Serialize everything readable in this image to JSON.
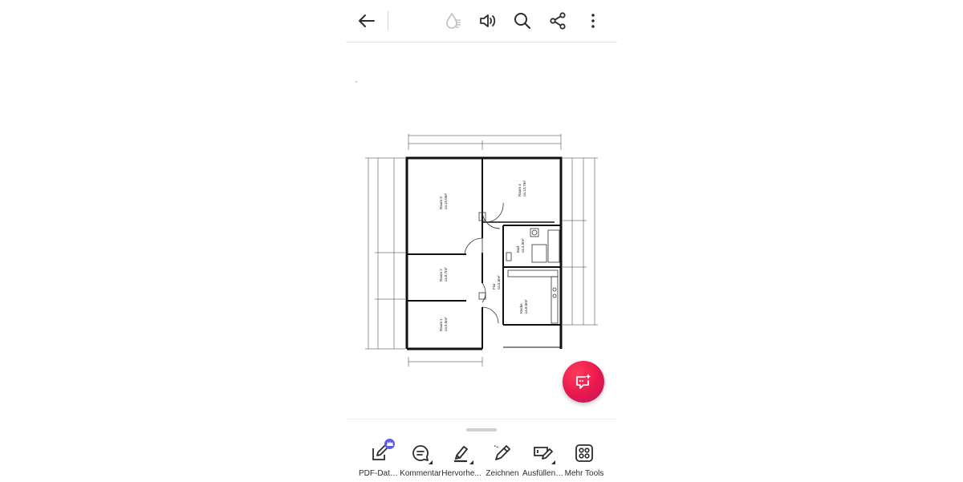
{
  "colors": {
    "fab_gradient_start": "#ff3b5c",
    "fab_gradient_end": "#b31a6a",
    "icon": "#2c2c2c",
    "icon_disabled": "#bdbdbd",
    "premium_badge": "#5c5ce0"
  },
  "topbar": {
    "icons": [
      "back-arrow-icon",
      "liquid-mode-icon",
      "read-aloud-icon",
      "search-icon",
      "share-icon",
      "more-vertical-icon"
    ]
  },
  "floorplan": {
    "rooms": [
      {
        "name": "Raum 3",
        "area": "ca.15,0m²"
      },
      {
        "name": "Raum 4",
        "area": "ca.13,7m²"
      },
      {
        "name": "Raum 2",
        "area": "ca.8,7m²"
      },
      {
        "name": "Raum 1",
        "area": "ca.9,5m²"
      },
      {
        "name": "Flur",
        "area": "ca.5,6m²"
      },
      {
        "name": "Bad",
        "area": "ca.4,9m²"
      },
      {
        "name": "Küche",
        "area": "ca.8,0m²"
      }
    ]
  },
  "fab": {
    "icon": "ai-assistant-icon"
  },
  "toolbar": {
    "tools": [
      {
        "label": "PDF-Datei...",
        "icon": "edit-pdf-icon"
      },
      {
        "label": "Kommentar",
        "icon": "comment-icon"
      },
      {
        "label": "Hervorhe...",
        "icon": "highlight-icon"
      },
      {
        "label": "Zeichnen",
        "icon": "draw-icon"
      },
      {
        "label": "Ausfüllen ...",
        "icon": "fill-sign-icon"
      },
      {
        "label": "Mehr Tools",
        "icon": "more-tools-icon"
      }
    ]
  }
}
